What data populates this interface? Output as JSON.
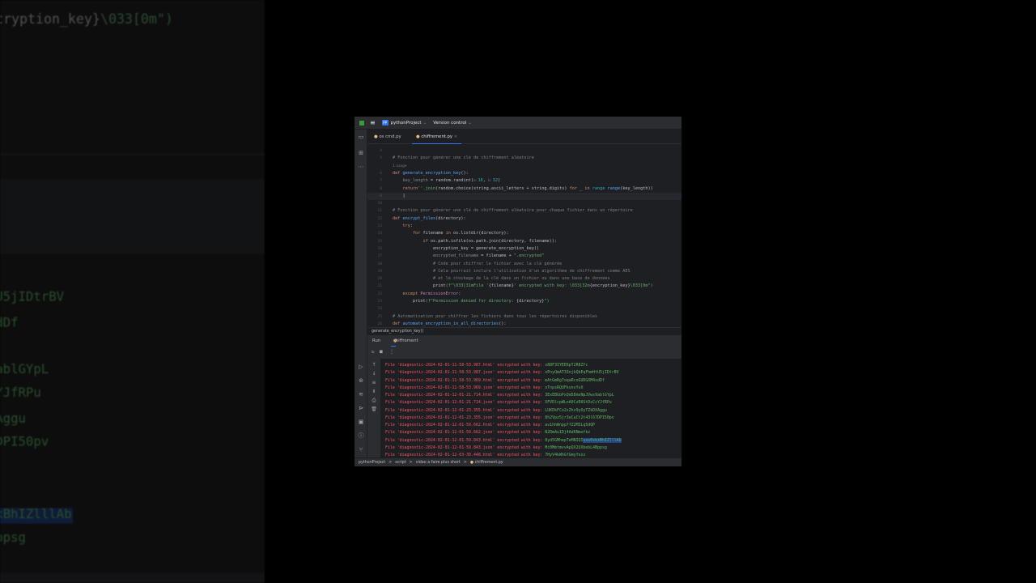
{
  "title_bar": {
    "project_badge": "PP",
    "project": "pythonProject",
    "vcs": "Version control"
  },
  "tabs": [
    {
      "label": "os cmd.py"
    },
    {
      "label": "chiffrement.py",
      "close": "×"
    }
  ],
  "editor": {
    "lines": [
      {
        "n": "4",
        "t": []
      },
      {
        "n": "5",
        "t": [
          [
            "# Fonction pour générer une clé de chiffrement aléatoire",
            "cm"
          ]
        ]
      },
      {
        "n": "",
        "t": [
          [
            "1 usage",
            "hint"
          ]
        ]
      },
      {
        "n": "6",
        "t": [
          [
            "def ",
            "kw"
          ],
          [
            "generate_encryption_key",
            "fn"
          ],
          [
            "():",
            "df"
          ]
        ]
      },
      {
        "n": "7",
        "t": [
          [
            "    key_length",
            "gr"
          ],
          [
            " = random.randint(",
            "df"
          ],
          [
            "a: ",
            "hint"
          ],
          [
            "16",
            "nu"
          ],
          [
            ", ",
            "df"
          ],
          [
            "b: ",
            "hint"
          ],
          [
            "32",
            "nu"
          ],
          [
            ")",
            "df"
          ]
        ]
      },
      {
        "n": "8",
        "t": [
          [
            "    return",
            "kw"
          ],
          [
            "''.join",
            "st"
          ],
          [
            "(random.choice(string.ascii_letters + string.digits) ",
            "df"
          ],
          [
            "for",
            "kw"
          ],
          [
            " _ ",
            "df"
          ],
          [
            "in",
            "kw"
          ],
          [
            " range ",
            "nu"
          ],
          [
            "range",
            "fn"
          ],
          [
            "(key_length))",
            "df"
          ]
        ]
      },
      {
        "n": "9",
        "t": [
          [
            "    |",
            "df"
          ]
        ],
        "cur": true
      },
      {
        "n": "10",
        "t": []
      },
      {
        "n": "11",
        "t": [
          [
            "# Fonction pour générer une clé de chiffrement aléatoire pour chaque fichier dans un répertoire",
            "cm"
          ]
        ]
      },
      {
        "n": "12",
        "t": [
          [
            "def ",
            "kw"
          ],
          [
            "encrypt_files",
            "fn"
          ],
          [
            "(directory):",
            "df"
          ]
        ]
      },
      {
        "n": "13",
        "t": [
          [
            "    try",
            "kw"
          ],
          [
            ":",
            "df"
          ]
        ]
      },
      {
        "n": "14",
        "t": [
          [
            "        for",
            "kw"
          ],
          [
            " filename ",
            "df"
          ],
          [
            "in",
            "kw"
          ],
          [
            " os.listdir(directory):",
            "df"
          ]
        ]
      },
      {
        "n": "15",
        "t": [
          [
            "            if",
            "kw"
          ],
          [
            " os.path.isfile(os.path.join(directory, filename)):",
            "df"
          ]
        ]
      },
      {
        "n": "16",
        "t": [
          [
            "                encryption_key = generate_encryption_key()",
            "df"
          ]
        ]
      },
      {
        "n": "17",
        "t": [
          [
            "                encrypted_filename",
            "gr"
          ],
          [
            " = filename + ",
            "df"
          ],
          [
            "\".encrypted\"",
            "st"
          ]
        ]
      },
      {
        "n": "18",
        "t": [
          [
            "                # Code pour chiffrer le fichier avec la clé générée",
            "cm"
          ]
        ]
      },
      {
        "n": "19",
        "t": [
          [
            "                # Cela pourrait inclure l'utilisation d'un algorithme de chiffrement comme AES",
            "cm"
          ]
        ]
      },
      {
        "n": "20",
        "t": [
          [
            "                # et le stockage de la clé dans un fichier ou dans une base de données",
            "cm"
          ]
        ]
      },
      {
        "n": "21",
        "t": [
          [
            "                print",
            "df"
          ],
          [
            "(f\"\\033[31mFile '",
            "st"
          ],
          [
            "{filename}",
            "df"
          ],
          [
            "' encrypted with key: \\033[32m",
            "st"
          ],
          [
            "{encryption_key}",
            "df"
          ],
          [
            "\\033[0m\")",
            "st"
          ]
        ]
      },
      {
        "n": "22",
        "t": [
          [
            "    except ",
            "kw"
          ],
          [
            "PermissionError",
            "cls"
          ],
          [
            ":",
            "df"
          ]
        ]
      },
      {
        "n": "23",
        "t": [
          [
            "        print",
            "df"
          ],
          [
            "(f\"Permission denied for directory: ",
            "st"
          ],
          [
            "{directory}",
            "df"
          ],
          [
            "\")",
            "st"
          ]
        ]
      },
      {
        "n": "24",
        "t": []
      },
      {
        "n": "25",
        "t": [
          [
            "# Automatisation pour chiffrer les fichiers dans tous les répertoires disponibles",
            "cm"
          ]
        ]
      },
      {
        "n": "26",
        "t": [
          [
            "def ",
            "kw"
          ],
          [
            "automate_encryption_in_all_directories",
            "fn"
          ],
          [
            "():",
            "df"
          ]
        ]
      }
    ]
  },
  "breadcrumb_fn": "generate_encryption_key()",
  "run": {
    "label": "Run",
    "tab": "chiffrement",
    "close": "×",
    "output": [
      {
        "file": "diagnostic-2024-02-01-11-58-53.987.html",
        "key": "v88F3IYEE6pT2R8Zfc"
      },
      {
        "file": "diagnostic-2024-02-01-11-58-53.987.json",
        "key": "xPnyQmAT33njkQbEqFhmHtU5jIDtrBV"
      },
      {
        "file": "diagnostic-2024-02-01-11-58-53.969.html",
        "key": "mAtGmRg7oqaRcoGUDGXM4sdDf"
      },
      {
        "file": "diagnostic-2024-02-01-11-58-53.969.json",
        "key": "oTnpsRQUFkvnvYvX"
      },
      {
        "file": "diagnostic-2024-02-01-12-01-21.714.html",
        "key": "3ExEBGbPxQm5DmxNpJVws9ablGYpL"
      },
      {
        "file": "diagnostic-2024-02-01-12-01-21.714.json",
        "key": "XFVDlcpWLnA0CzR0StDsCcYJfRPu"
      },
      {
        "file": "diagnostic-2024-02-01-12-01-23.355.html",
        "key": "LUKDkFCo2sZhz9yOyTZkDXAggu"
      },
      {
        "file": "diagnostic-2024-02-01-12-01-23.355.json",
        "key": "8h2Vpz5jr3eCuCt2t43l67DPI50pv"
      },
      {
        "file": "diagnostic-2024-02-01-12-01-59.662.html",
        "key": "av1hhWnpp7fZ2M3Lq5dQP"
      },
      {
        "file": "diagnostic-2024-02-01-12-01-59.662.json",
        "key": "N2DmAu1Dj4AdKNmofkz"
      },
      {
        "file": "diagnostic-2024-02-01-12-01-59.843.html",
        "key": "8yd5GMhepTeMNIQI",
        "sel": "uso0skxBhIZlllAb"
      },
      {
        "file": "diagnostic-2024-02-01-12-01-59.843.json",
        "key": "Mc0MmtmvvApQX2UXbebL4Bppsg"
      },
      {
        "file": "diagnostic-2024-02-01-12-03-39.448.html",
        "key": "7HyV4kWhGfGmyfozz"
      }
    ],
    "prefix": "File '",
    "mid": "' encrypted with key: "
  },
  "status": {
    "path": [
      "pythonProject",
      "script",
      "video a faire plus short",
      "chiffrement.py"
    ],
    "sep": ">"
  }
}
